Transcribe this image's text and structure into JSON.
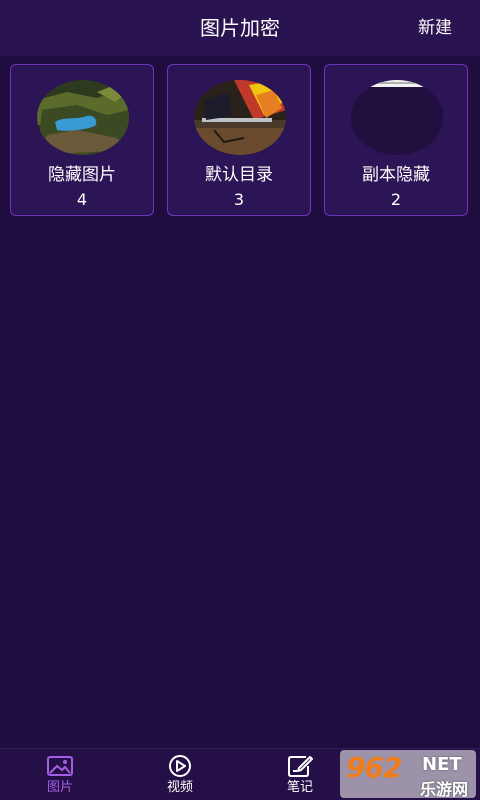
{
  "header": {
    "title": "图片加密",
    "new_label": "新建"
  },
  "albums": [
    {
      "name": "隐藏图片",
      "count": "4"
    },
    {
      "name": "默认目录",
      "count": "3"
    },
    {
      "name": "副本隐藏",
      "count": "2"
    }
  ],
  "tabs": [
    {
      "label": "图片",
      "icon": "image-icon",
      "active": true
    },
    {
      "label": "视频",
      "icon": "play-icon",
      "active": false
    },
    {
      "label": "笔记",
      "icon": "note-edit-icon",
      "active": false
    }
  ],
  "watermark": {
    "logo": "962",
    "net": "NET",
    "site": "乐游网"
  },
  "colors": {
    "background": "#1f0d3f",
    "header": "#291350",
    "card": "#2c1556",
    "card_border": "#6d36b8",
    "active_tab": "#a35de6"
  }
}
